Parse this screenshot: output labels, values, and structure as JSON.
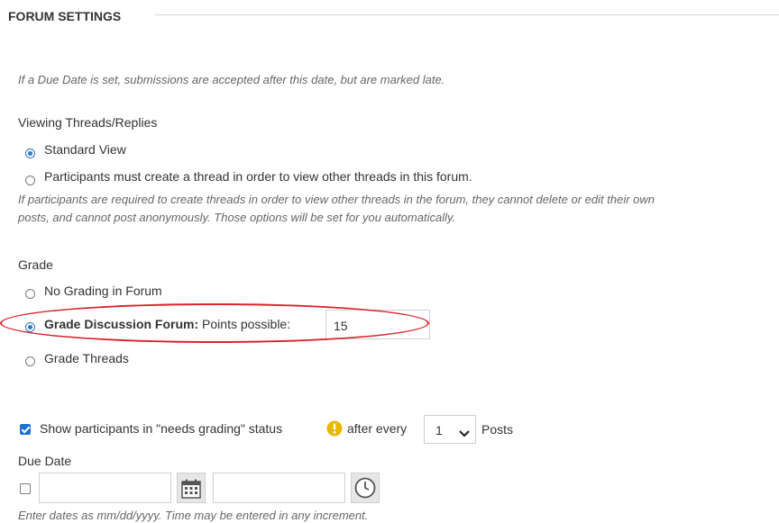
{
  "section": {
    "title": "FORUM SETTINGS"
  },
  "due_date_note": "If a Due Date is set, submissions are accepted after this date, but are marked late.",
  "viewing": {
    "heading": "Viewing Threads/Replies",
    "options": [
      {
        "label": "Standard View",
        "selected": true
      },
      {
        "label": "Participants must create a thread in order to view other threads in this forum.",
        "selected": false
      }
    ],
    "help_line1": "If participants are required to create threads in order to view other threads in the forum, they cannot delete or edit their own",
    "help_line2": "posts, and cannot post anonymously. Those options will be set for you automatically."
  },
  "grade": {
    "heading": "Grade",
    "option_none": "No Grading in Forum",
    "option_forum_bold": "Grade Discussion Forum:",
    "option_forum_points_label": "Points possible:",
    "points_value": "15",
    "option_threads": "Grade Threads",
    "selected": "forum"
  },
  "needs_grading": {
    "checked": true,
    "label_before": "Show participants in \"needs grading\" status",
    "label_after_icon": "after every",
    "count": "1",
    "label_posts": "Posts"
  },
  "due_date": {
    "heading": "Due Date",
    "checked": false,
    "date_value": "",
    "time_value": "",
    "help": "Enter dates as mm/dd/yyyy. Time may be entered in any increment."
  },
  "colors": {
    "highlight": "#d9232d",
    "accent": "#2f78c8",
    "warning_icon": "#e8b800"
  },
  "icons": [
    "calendar-icon",
    "clock-icon",
    "warning-icon",
    "chevron-down-icon"
  ]
}
